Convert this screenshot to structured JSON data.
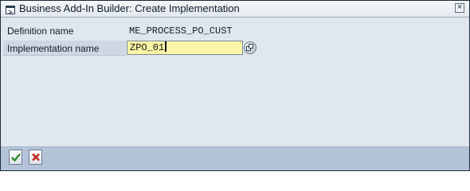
{
  "window": {
    "title": "Business Add-In Builder: Create Implementation",
    "close_glyph": "×"
  },
  "form": {
    "definition_label": "Definition name",
    "definition_value": "ME_PROCESS_PO_CUST",
    "implementation_label": "Implementation name",
    "implementation_value": "ZPO_01"
  },
  "toolbar": {
    "ok_icon": "check-icon",
    "cancel_icon": "cancel-icon"
  },
  "colors": {
    "input_highlight": "#fff7a8",
    "footer_bar": "#b3c3d9",
    "ok_green": "#2e8b2e",
    "cancel_red": "#c0281e"
  }
}
